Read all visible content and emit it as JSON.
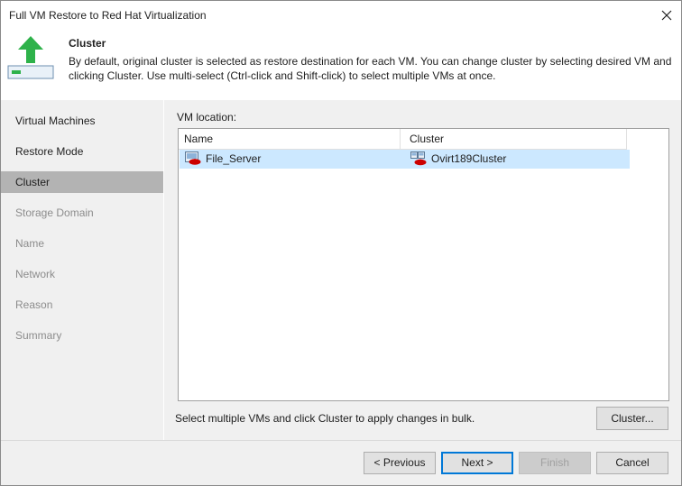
{
  "window": {
    "title": "Full VM Restore to Red Hat Virtualization"
  },
  "header": {
    "heading": "Cluster",
    "description": "By default, original cluster is selected as restore destination for each VM. You can change cluster by selecting desired VM and clicking Cluster. Use multi-select (Ctrl-click and Shift-click) to select multiple VMs at once."
  },
  "sidebar": {
    "items": [
      {
        "label": "Virtual Machines",
        "state": "done"
      },
      {
        "label": "Restore Mode",
        "state": "done"
      },
      {
        "label": "Cluster",
        "state": "active"
      },
      {
        "label": "Storage Domain",
        "state": "todo"
      },
      {
        "label": "Name",
        "state": "todo"
      },
      {
        "label": "Network",
        "state": "todo"
      },
      {
        "label": "Reason",
        "state": "todo"
      },
      {
        "label": "Summary",
        "state": "todo"
      }
    ]
  },
  "main": {
    "location_label": "VM location:",
    "columns": {
      "name": "Name",
      "cluster": "Cluster"
    },
    "rows": [
      {
        "name": "File_Server",
        "cluster": "Ovirt189Cluster",
        "selected": true
      }
    ],
    "bulk_hint": "Select multiple VMs and click Cluster to apply changes in bulk.",
    "cluster_button": "Cluster..."
  },
  "footer": {
    "previous": "< Previous",
    "next": "Next >",
    "finish": "Finish",
    "cancel": "Cancel"
  },
  "colors": {
    "accent": "#0078d7",
    "selection": "#cce8ff",
    "sidebar_active": "#b3b3b3",
    "icon_green": "#2eb24a",
    "redhat_red": "#cc0000"
  },
  "icons": {
    "close": "close-icon",
    "header": "restore-upload-icon",
    "vm": "redhat-vm-icon",
    "cluster": "redhat-cluster-icon"
  }
}
